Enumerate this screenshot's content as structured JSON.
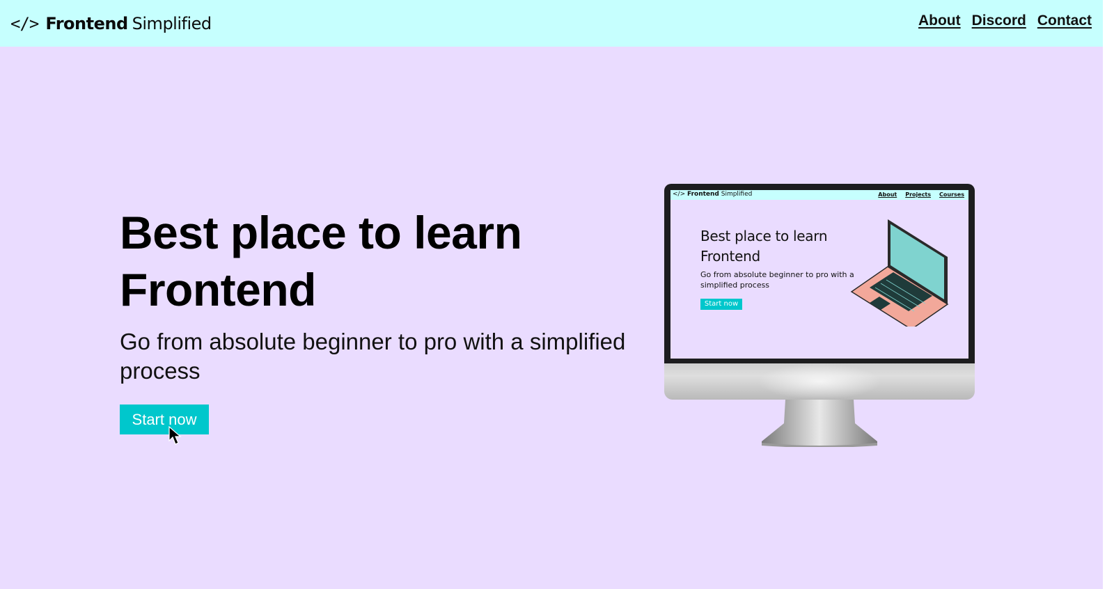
{
  "nav": {
    "logo_icon": "</>",
    "logo_strong": "Frontend",
    "logo_light": "Simplified",
    "links": [
      "About",
      "Discord",
      "Contact"
    ]
  },
  "hero": {
    "title_line1": "Best place to learn",
    "title_line2": "Frontend",
    "subtitle": "Go from absolute beginner to pro with a simplified process",
    "cta_label": "Start now"
  },
  "illustration": {
    "logo_icon": "</>",
    "logo_strong": "Frontend",
    "logo_light": "Simplified",
    "links": [
      "About",
      "Projects",
      "Courses"
    ],
    "title_line1": "Best place to learn",
    "title_line2": "Frontend",
    "subtitle": "Go from absolute beginner to pro with a simplified process",
    "cta_label": "Start now"
  },
  "colors": {
    "nav_bg": "#c6fffe",
    "page_bg": "#eadcff",
    "accent": "#00c7cc"
  },
  "icons": [
    "code-brackets-icon",
    "mouse-pointer-icon",
    "laptop-icon"
  ]
}
